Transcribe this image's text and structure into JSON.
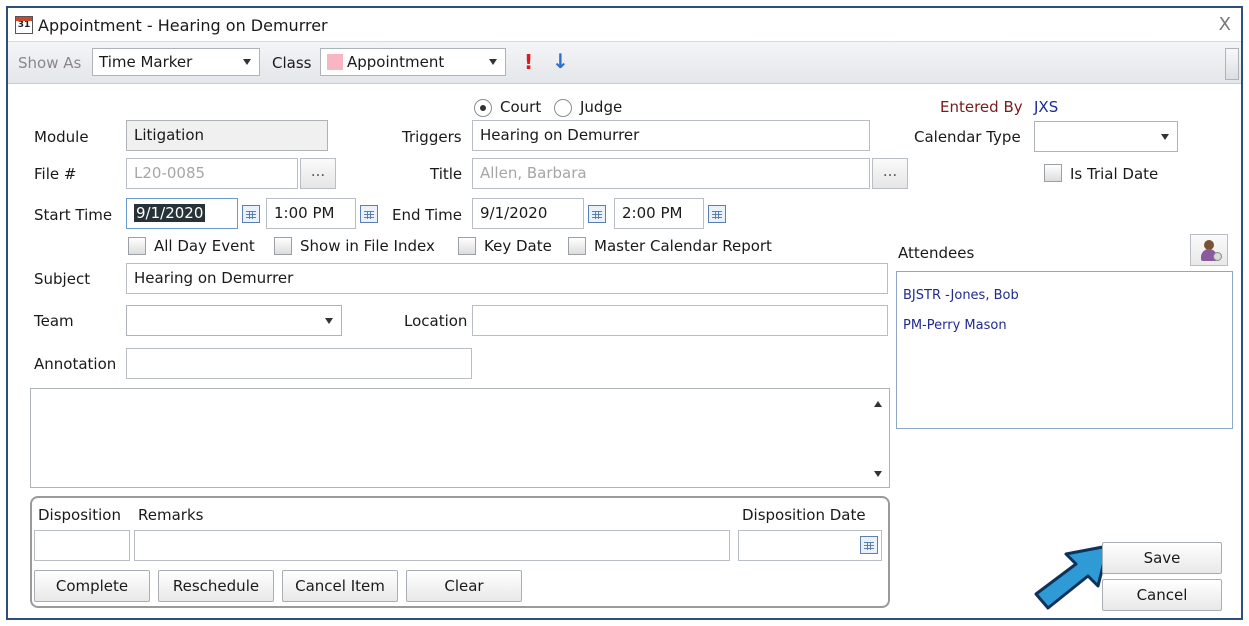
{
  "window": {
    "title": "Appointment - Hearing on Demurrer",
    "icon_text": "31",
    "close": "X"
  },
  "toolbar": {
    "show_as_label": "Show As",
    "show_as_value": "Time Marker",
    "class_label": "Class",
    "class_value": "Appointment",
    "class_color": "#f7b6c2",
    "priority_high_icon": "!",
    "priority_low_icon": "↓"
  },
  "form": {
    "court_label": "Court",
    "judge_label": "Judge",
    "entered_by_label": "Entered By",
    "entered_by_value": "JXS",
    "module_label": "Module",
    "module_value": "Litigation",
    "triggers_label": "Triggers",
    "triggers_value": "Hearing on Demurrer",
    "calendar_type_label": "Calendar Type",
    "calendar_type_value": "",
    "file_label": "File #",
    "file_value": "L20-0085",
    "ellipsis": "...",
    "title_label": "Title",
    "title_value": "Allen, Barbara",
    "is_trial_date_label": "Is Trial Date",
    "start_time_label": "Start Time",
    "start_date_value": "9/1/2020",
    "start_time_value": "1:00 PM",
    "end_time_label": "End Time",
    "end_date_value": "9/1/2020",
    "end_time_value": "2:00 PM",
    "all_day_label": "All Day Event",
    "show_in_index_label": "Show in File Index",
    "key_date_label": "Key Date",
    "master_cal_label": "Master Calendar Report",
    "subject_label": "Subject",
    "subject_value": "Hearing on Demurrer",
    "team_label": "Team",
    "team_value": "",
    "location_label": "Location",
    "location_value": "",
    "annotation_label": "Annotation",
    "annotation_value": "",
    "notes_value": ""
  },
  "attendees": {
    "label": "Attendees",
    "items": [
      "BJSTR  -Jones, Bob",
      "PM-Perry Mason"
    ]
  },
  "disposition": {
    "disposition_label": "Disposition",
    "remarks_label": "Remarks",
    "disposition_date_label": "Disposition Date",
    "disposition_value": "",
    "remarks_value": "",
    "disposition_date_value": "",
    "complete_label": "Complete",
    "reschedule_label": "Reschedule",
    "cancel_item_label": "Cancel Item",
    "clear_label": "Clear"
  },
  "actions": {
    "save_label": "Save",
    "cancel_label": "Cancel"
  },
  "colors": {
    "entered_by_label": "#7a1a1a",
    "entered_by_value": "#1a2a9a",
    "priority_high": "#e01818",
    "priority_low": "#2e6fc7",
    "callout_arrow": "#2e9bd6"
  }
}
